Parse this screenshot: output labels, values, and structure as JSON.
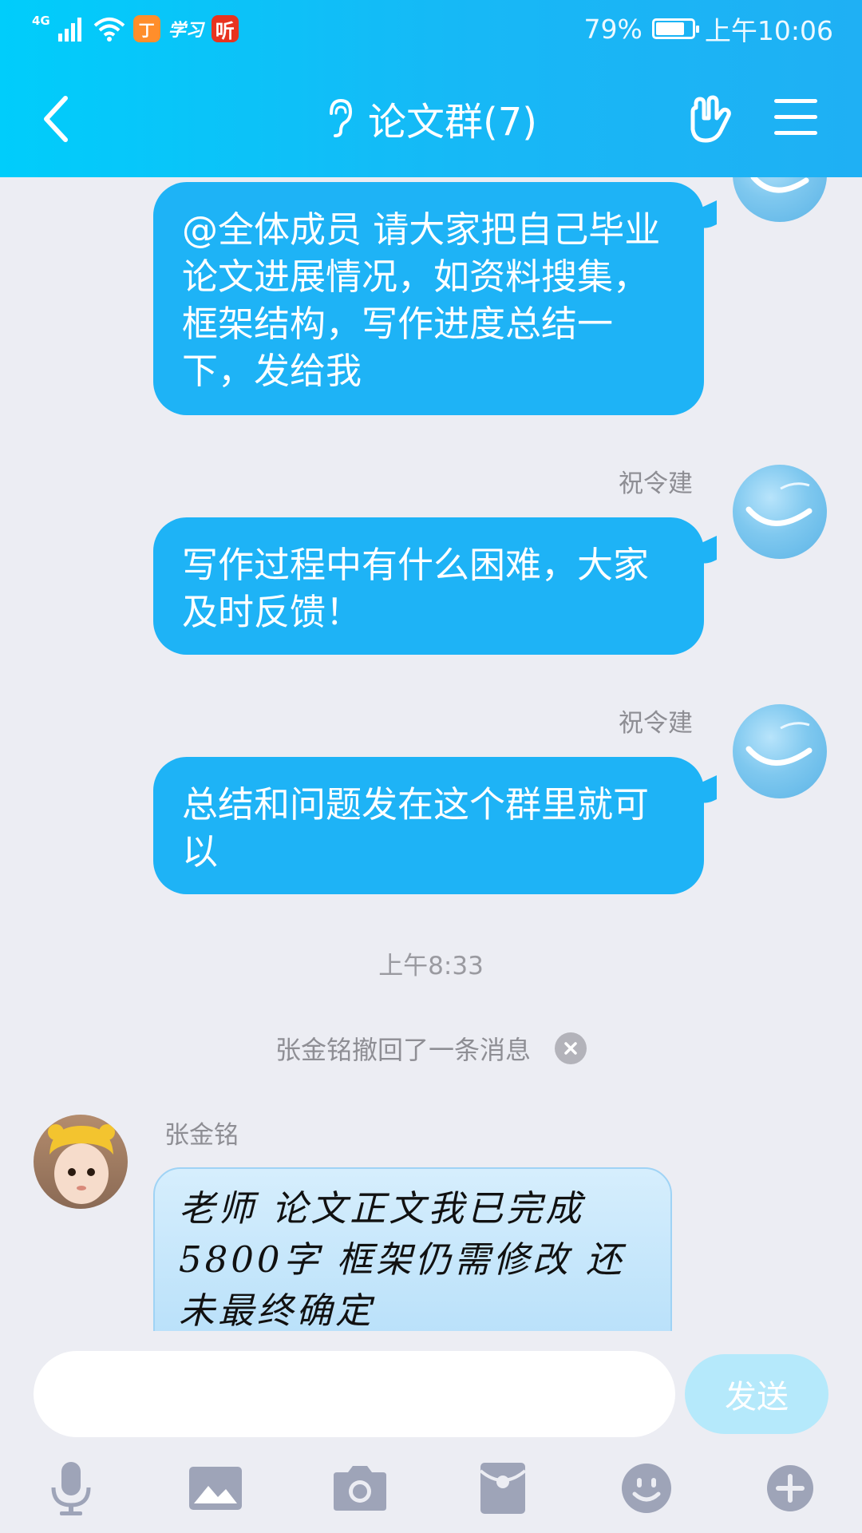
{
  "status_bar": {
    "network": "4G",
    "app_tingji": "丁",
    "app_xuexi": "学习",
    "app_ting": "听",
    "battery_percent": "79%",
    "battery_level": 0.79,
    "time": "上午10:06"
  },
  "header": {
    "title": "论文群(7)",
    "back_icon": "chevron-left-icon",
    "ear_icon": "ear-icon",
    "hand_icon": "hand-gesture-icon",
    "menu_icon": "menu-icon"
  },
  "messages": [
    {
      "sender": "",
      "text": "@全体成员 请大家把自己毕业论文进展情况，如资料搜集，框架结构，写作进度总结一下，发给我"
    },
    {
      "sender": "祝令建",
      "text": "写作过程中有什么困难，大家及时反馈！"
    },
    {
      "sender": "祝令建",
      "text": "总结和问题发在这个群里就可以"
    }
  ],
  "timestamp": "上午8:33",
  "recall_notice": "张金铭撤回了一条消息",
  "incoming": {
    "sender": "张金铭",
    "line1": "老师 论文正文我已完成",
    "line2": "5800字  框架仍需修改 还",
    "line3": "未最终确定"
  },
  "input": {
    "placeholder": "",
    "send_label": "发送"
  },
  "toolbar": [
    "microphone-icon",
    "image-icon",
    "camera-icon",
    "red-packet-icon",
    "emoji-icon",
    "plus-icon"
  ],
  "colors": {
    "header_start": "#00cdfb",
    "header_end": "#1fb0f4",
    "bubble_out": "#1eb3f6",
    "background": "#ecedf3"
  }
}
